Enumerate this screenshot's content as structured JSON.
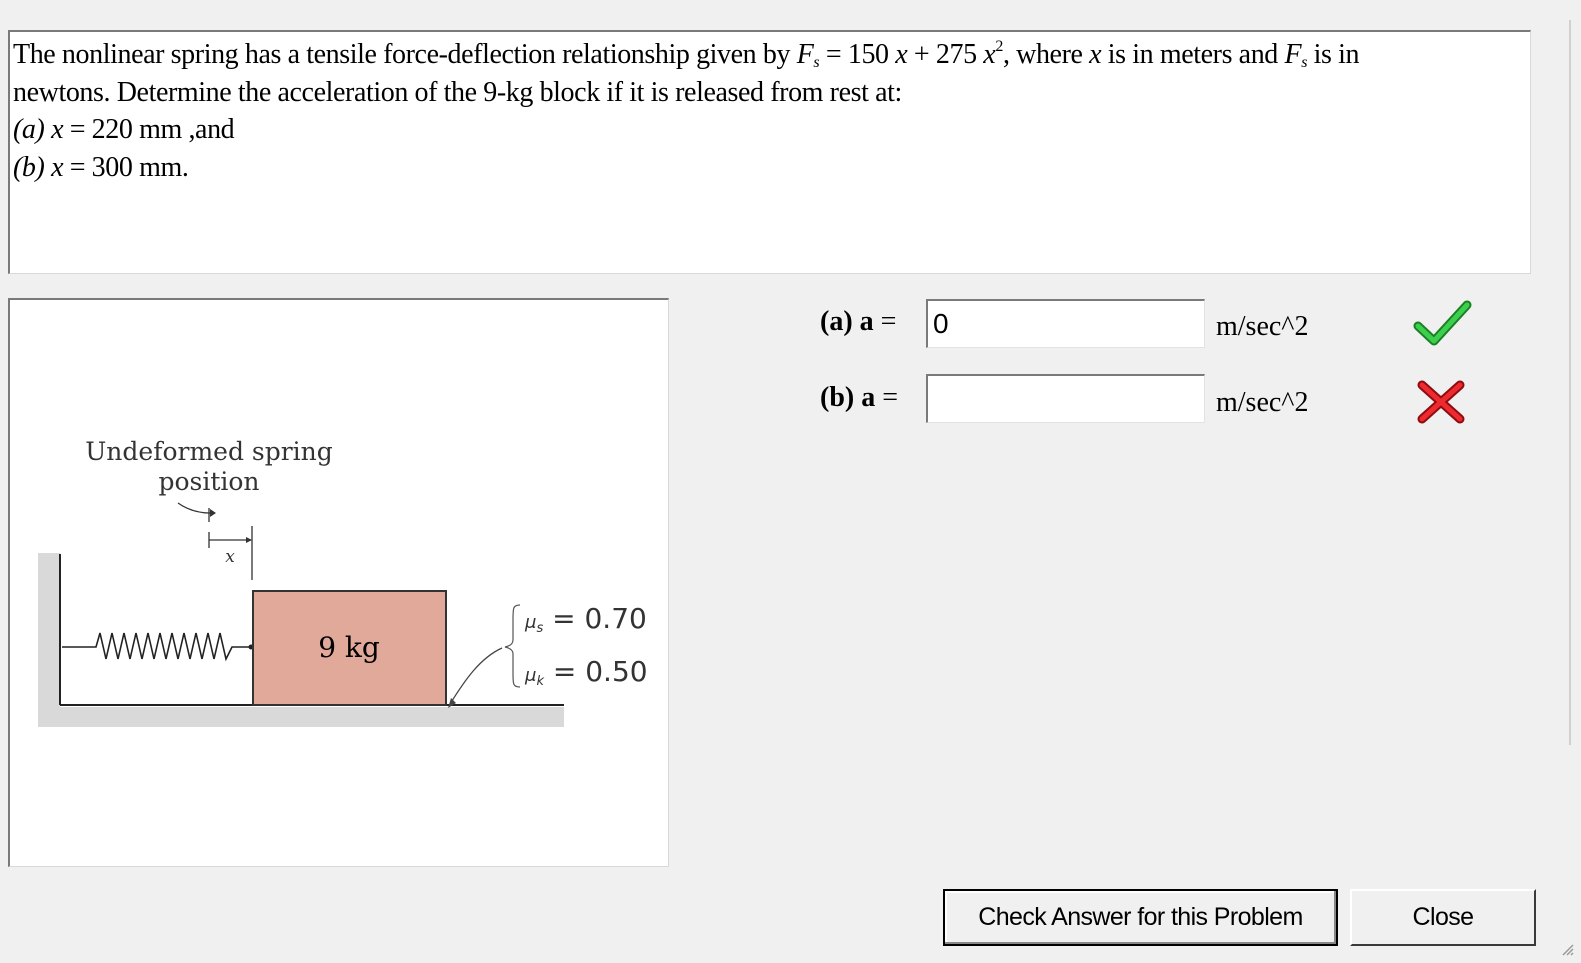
{
  "problem": {
    "line1_prefix": "The nonlinear spring has a tensile force-deflection relationship given by",
    "force_symbol": "F",
    "force_subscript": "s",
    "equation_rhs_a": "= 150 ",
    "var_x": "x",
    "equation_rhs_b": " + 275 ",
    "exponent": "2",
    "line1_suffix_a": ", where ",
    "line1_suffix_b": " is in meters and ",
    "line1_suffix_c": " is in",
    "line2": "newtons. Determine the acceleration of the 9-kg block if it is released from rest at:",
    "part_a_label": "(a)",
    "part_a_text": " = 220 mm ,and",
    "part_b_label": "(b)",
    "part_b_text": " = 300 mm."
  },
  "figure": {
    "label_line1": "Undeformed spring",
    "label_line2": "position",
    "x_label": "x",
    "mass_label": "9 kg",
    "mu_s": "μs = 0.70",
    "mu_k": "μk = 0.50",
    "mu_symbol": "μ",
    "mu_s_sub": "s",
    "mu_s_value": " = 0.70",
    "mu_k_sub": "k",
    "mu_k_value": " = 0.50"
  },
  "answers": {
    "a": {
      "label": "(a) a",
      "eq": " =",
      "value": "0",
      "unit": "m/sec^2",
      "status": "correct",
      "status_color": "#22b14c"
    },
    "b": {
      "label": "(b) a",
      "eq": " =",
      "value": "",
      "unit": "m/sec^2",
      "status": "incorrect",
      "status_color": "#e8141c"
    }
  },
  "buttons": {
    "check": "Check Answer for this Problem",
    "close": "Close"
  }
}
